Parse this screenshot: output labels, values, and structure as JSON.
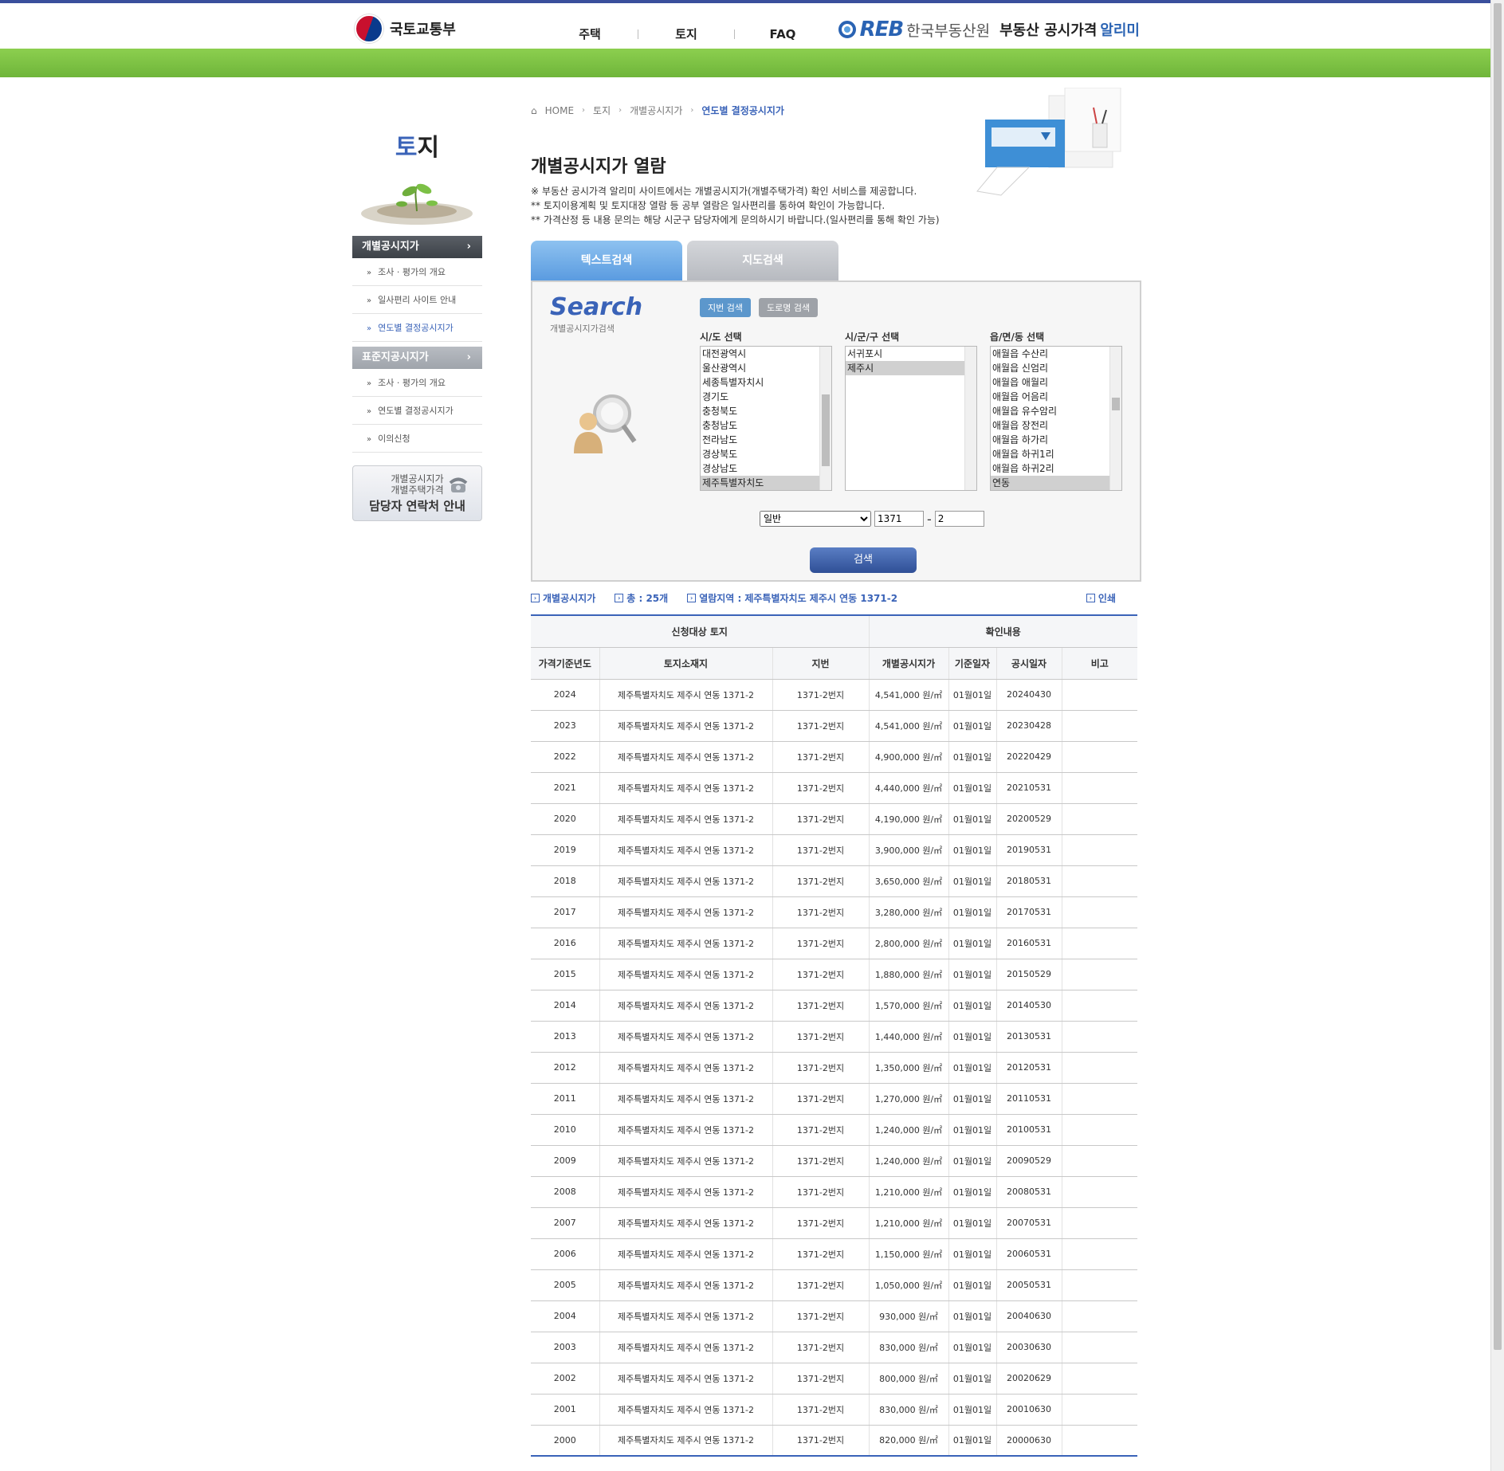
{
  "header": {
    "ministry": "국토교통부",
    "nav": [
      "주택",
      "토지",
      "FAQ"
    ],
    "reb_mark": "REB",
    "reb_org": "한국부동산원",
    "service": "부동산 공시가격",
    "alimi": "알리미"
  },
  "lnb": {
    "title_blue": "토",
    "title_rest": "지",
    "groups": [
      {
        "head": "개별공시지가",
        "items": [
          "조사 · 평가의 개요",
          "일사편리 사이트 안내",
          "연도별 결정공시지가"
        ]
      },
      {
        "head": "표준지공시지가",
        "items": [
          "조사 · 평가의 개요",
          "연도별 결정공시지가",
          "이의신청"
        ]
      }
    ],
    "contact_line1": "개별공시지가",
    "contact_line2": "개별주택가격",
    "contact_line3": "담당자 연락처 안내"
  },
  "breadcrumb": {
    "home": "HOME",
    "b1": "토지",
    "b2": "개별공시지가",
    "current": "연도별 결정공시지가"
  },
  "page": {
    "title": "개별공시지가 열람",
    "note1": "※ 부동산 공시가격 알리미 사이트에서는 개별공시지가(개별주택가격) 확인 서비스를 제공합니다.",
    "note2": "** 토지이용계획 및 토지대장 열람 등 공부 열람은 일사편리를 통하여 확인이 가능합니다.",
    "note3": "** 가격산정 등 내용 문의는 해당 시군구 담당자에게 문의하시기 바랍니다.(일사편리를 통해 확인 가능)"
  },
  "tabs": {
    "text_search": "텍스트검색",
    "map_search": "지도검색"
  },
  "search": {
    "title": "Search",
    "subtitle": "개별공시지가검색",
    "btn_jibun": "지번 검색",
    "btn_road": "도로명 검색",
    "sido_label": "시/도 선택",
    "sigungu_label": "시/군/구 선택",
    "eupmyeondong_label": "읍/면/동 선택",
    "sido_options": [
      "대전광역시",
      "울산광역시",
      "세종특별자치시",
      "경기도",
      "충청북도",
      "충청남도",
      "전라남도",
      "경상북도",
      "경상남도",
      "제주특별자치도"
    ],
    "sido_selected": "제주특별자치도",
    "sigungu_options": [
      "서귀포시",
      "제주시"
    ],
    "sigungu_selected": "제주시",
    "dong_options": [
      "애월읍 수산리",
      "애월읍 신엄리",
      "애월읍 애월리",
      "애월읍 어음리",
      "애월읍 유수암리",
      "애월읍 장전리",
      "애월읍 하가리",
      "애월읍 하귀1리",
      "애월읍 하귀2리",
      "연동"
    ],
    "dong_selected": "연동",
    "land_type": "일반",
    "bonbun": "1371",
    "bubun": "2",
    "dash": "-",
    "search_button": "검색"
  },
  "info": {
    "label": "개별공시지가",
    "total": "총 : 25개",
    "region_label": "열람지역 :",
    "region": "제주특별자치도 제주시 연동 1371-2",
    "print": "인쇄"
  },
  "table": {
    "group1": "신청대상 토지",
    "group2": "확인내용",
    "headers": [
      "가격기준년도",
      "토지소재지",
      "지번",
      "개별공시지가",
      "기준일자",
      "공시일자",
      "비고"
    ],
    "rows": [
      [
        "2024",
        "제주특별자치도 제주시 연동 1371-2",
        "1371-2번지",
        "4,541,000 원/㎡",
        "01월01일",
        "20240430",
        ""
      ],
      [
        "2023",
        "제주특별자치도 제주시 연동 1371-2",
        "1371-2번지",
        "4,541,000 원/㎡",
        "01월01일",
        "20230428",
        ""
      ],
      [
        "2022",
        "제주특별자치도 제주시 연동 1371-2",
        "1371-2번지",
        "4,900,000 원/㎡",
        "01월01일",
        "20220429",
        ""
      ],
      [
        "2021",
        "제주특별자치도 제주시 연동 1371-2",
        "1371-2번지",
        "4,440,000 원/㎡",
        "01월01일",
        "20210531",
        ""
      ],
      [
        "2020",
        "제주특별자치도 제주시 연동 1371-2",
        "1371-2번지",
        "4,190,000 원/㎡",
        "01월01일",
        "20200529",
        ""
      ],
      [
        "2019",
        "제주특별자치도 제주시 연동 1371-2",
        "1371-2번지",
        "3,900,000 원/㎡",
        "01월01일",
        "20190531",
        ""
      ],
      [
        "2018",
        "제주특별자치도 제주시 연동 1371-2",
        "1371-2번지",
        "3,650,000 원/㎡",
        "01월01일",
        "20180531",
        ""
      ],
      [
        "2017",
        "제주특별자치도 제주시 연동 1371-2",
        "1371-2번지",
        "3,280,000 원/㎡",
        "01월01일",
        "20170531",
        ""
      ],
      [
        "2016",
        "제주특별자치도 제주시 연동 1371-2",
        "1371-2번지",
        "2,800,000 원/㎡",
        "01월01일",
        "20160531",
        ""
      ],
      [
        "2015",
        "제주특별자치도 제주시 연동 1371-2",
        "1371-2번지",
        "1,880,000 원/㎡",
        "01월01일",
        "20150529",
        ""
      ],
      [
        "2014",
        "제주특별자치도 제주시 연동 1371-2",
        "1371-2번지",
        "1,570,000 원/㎡",
        "01월01일",
        "20140530",
        ""
      ],
      [
        "2013",
        "제주특별자치도 제주시 연동 1371-2",
        "1371-2번지",
        "1,440,000 원/㎡",
        "01월01일",
        "20130531",
        ""
      ],
      [
        "2012",
        "제주특별자치도 제주시 연동 1371-2",
        "1371-2번지",
        "1,350,000 원/㎡",
        "01월01일",
        "20120531",
        ""
      ],
      [
        "2011",
        "제주특별자치도 제주시 연동 1371-2",
        "1371-2번지",
        "1,270,000 원/㎡",
        "01월01일",
        "20110531",
        ""
      ],
      [
        "2010",
        "제주특별자치도 제주시 연동 1371-2",
        "1371-2번지",
        "1,240,000 원/㎡",
        "01월01일",
        "20100531",
        ""
      ],
      [
        "2009",
        "제주특별자치도 제주시 연동 1371-2",
        "1371-2번지",
        "1,240,000 원/㎡",
        "01월01일",
        "20090529",
        ""
      ],
      [
        "2008",
        "제주특별자치도 제주시 연동 1371-2",
        "1371-2번지",
        "1,210,000 원/㎡",
        "01월01일",
        "20080531",
        ""
      ],
      [
        "2007",
        "제주특별자치도 제주시 연동 1371-2",
        "1371-2번지",
        "1,210,000 원/㎡",
        "01월01일",
        "20070531",
        ""
      ],
      [
        "2006",
        "제주특별자치도 제주시 연동 1371-2",
        "1371-2번지",
        "1,150,000 원/㎡",
        "01월01일",
        "20060531",
        ""
      ],
      [
        "2005",
        "제주특별자치도 제주시 연동 1371-2",
        "1371-2번지",
        "1,050,000 원/㎡",
        "01월01일",
        "20050531",
        ""
      ],
      [
        "2004",
        "제주특별자치도 제주시 연동 1371-2",
        "1371-2번지",
        "930,000 원/㎡",
        "01월01일",
        "20040630",
        ""
      ],
      [
        "2003",
        "제주특별자치도 제주시 연동 1371-2",
        "1371-2번지",
        "830,000 원/㎡",
        "01월01일",
        "20030630",
        ""
      ],
      [
        "2002",
        "제주특별자치도 제주시 연동 1371-2",
        "1371-2번지",
        "800,000 원/㎡",
        "01월01일",
        "20020629",
        ""
      ],
      [
        "2001",
        "제주특별자치도 제주시 연동 1371-2",
        "1371-2번지",
        "830,000 원/㎡",
        "01월01일",
        "20010630",
        ""
      ],
      [
        "2000",
        "제주특별자치도 제주시 연동 1371-2",
        "1371-2번지",
        "820,000 원/㎡",
        "01월01일",
        "20000630",
        ""
      ]
    ]
  },
  "colors": {
    "brand_blue": "#3a63b8",
    "green": "#7ec345",
    "top_line": "#3a4f9c"
  }
}
